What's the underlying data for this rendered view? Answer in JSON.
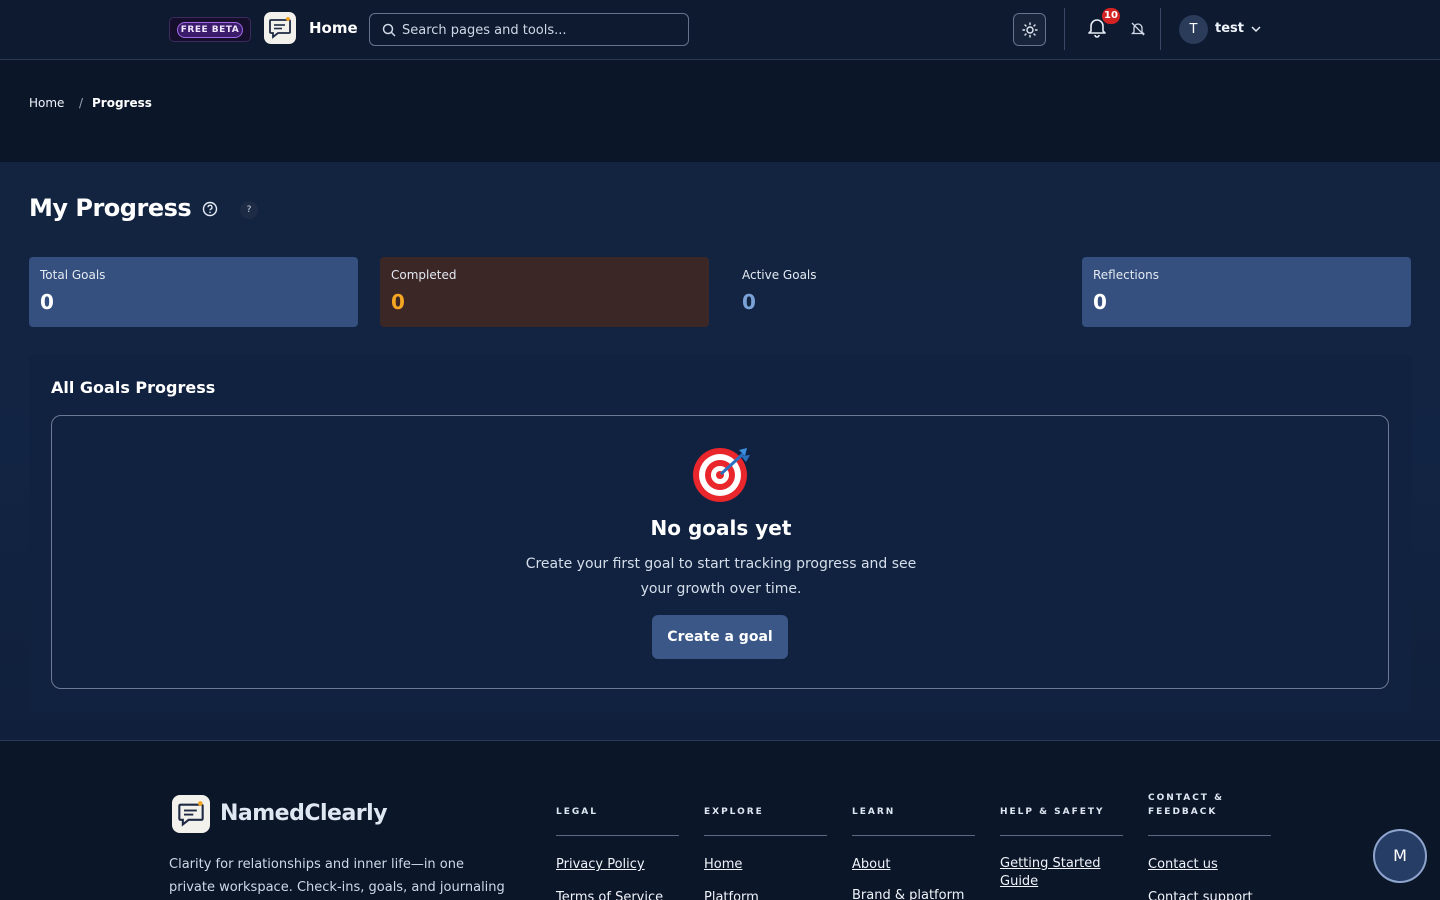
{
  "header": {
    "beta_label": "FREE BETA",
    "home_label": "Home",
    "search_placeholder": "Search pages and tools...",
    "notifications_count": "10",
    "user_initial": "T",
    "user_name": "test"
  },
  "breadcrumb": {
    "home": "Home",
    "separator": "/",
    "current": "Progress"
  },
  "page": {
    "title": "My Progress",
    "help_badge": "?"
  },
  "stats": [
    {
      "label": "Total Goals",
      "value": "0",
      "color": "#ffffff"
    },
    {
      "label": "Completed",
      "value": "0",
      "color": "#f5a623"
    },
    {
      "label": "Active Goals",
      "value": "0",
      "color": "#7aa2d6"
    },
    {
      "label": "Reflections",
      "value": "0",
      "color": "#ffffff"
    }
  ],
  "goals_panel": {
    "title": "All Goals Progress",
    "empty_title": "No goals yet",
    "empty_description": "Create your first goal to start tracking progress and see your growth over time.",
    "create_button": "Create a goal"
  },
  "footer": {
    "brand": "NamedClearly",
    "tagline": "Clarity for relationships and inner life—in one private workspace. Check-ins, goals, and journaling with",
    "columns": [
      {
        "heading": "LEGAL",
        "links": [
          "Privacy Policy",
          "Terms of Service"
        ]
      },
      {
        "heading": "EXPLORE",
        "links": [
          "Home",
          "Platform"
        ]
      },
      {
        "heading": "LEARN",
        "links": [
          "About",
          "Brand & platform"
        ]
      },
      {
        "heading": "HELP & SAFETY",
        "links": [
          "Getting Started Guide"
        ]
      },
      {
        "heading": "CONTACT & FEEDBACK",
        "links": [
          "Contact us",
          "Contact support"
        ]
      }
    ]
  },
  "assistant_button": "M",
  "colors": {
    "background": "#0b1629",
    "accent": "#3a5788",
    "notification": "#d42222",
    "completed": "#f5a623"
  }
}
